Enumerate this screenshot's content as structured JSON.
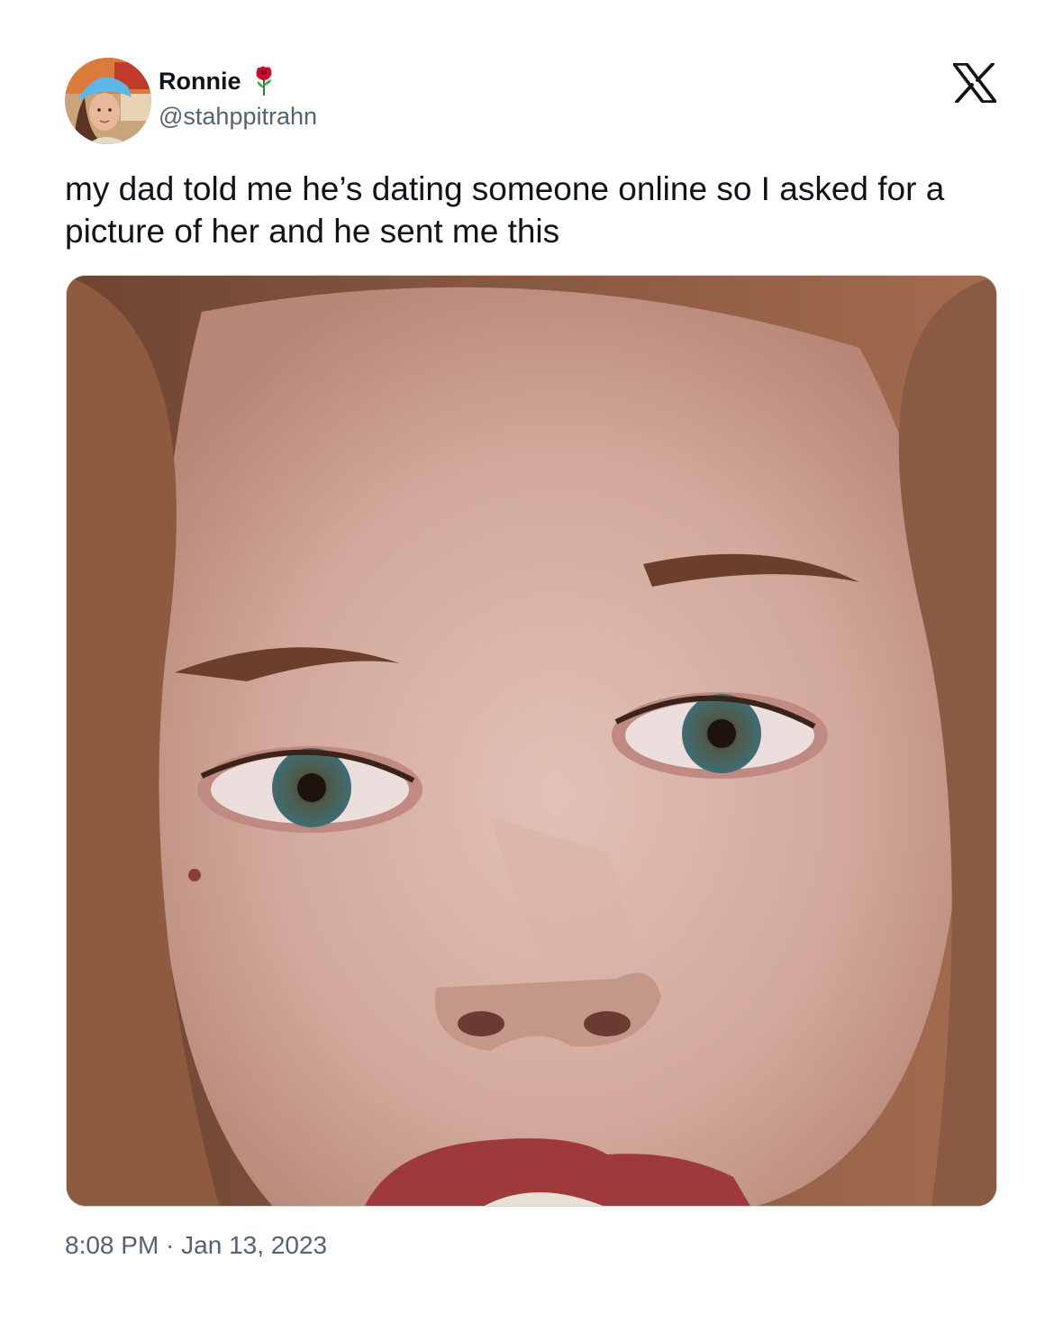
{
  "author": {
    "display_name": "Ronnie",
    "handle": "@stahppitrahn",
    "name_emoji": "rose-icon"
  },
  "brand": {
    "logo": "x-logo-icon"
  },
  "tweet": {
    "text": "my dad told me he’s dating someone online so I asked for a picture of her and he sent me this"
  },
  "timestamp": {
    "time": "8:08 PM",
    "separator": " · ",
    "date": "Jan 13, 2023"
  },
  "colors": {
    "text_primary": "#0f1419",
    "text_secondary": "#536471",
    "border": "#cfd9de",
    "rose": "#c8102e"
  }
}
